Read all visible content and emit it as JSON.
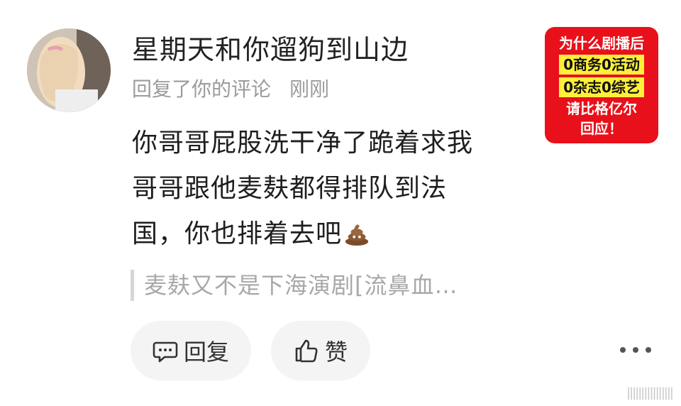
{
  "comment": {
    "username": "星期天和你遛狗到山边",
    "action": "回复了你的评论",
    "time": "刚刚",
    "body_lines": [
      "你哥哥屁股洗干净了跪着求我",
      "哥哥跟他麦麸都得排队到法",
      "国，你也排着去吧"
    ],
    "emoji": "poop-emoji",
    "quoted": "麦麸又不是下海演剧[流鼻血…"
  },
  "actions": {
    "reply_label": "回复",
    "like_label": "赞"
  },
  "ad": {
    "lines": [
      "为什么剧播后",
      "0商务0活动",
      "0杂志0综艺",
      "请比格亿尔",
      "回应！"
    ],
    "background": "#e8101a",
    "highlight": "#ffef3a"
  },
  "watermark": "||||||||||||||||"
}
